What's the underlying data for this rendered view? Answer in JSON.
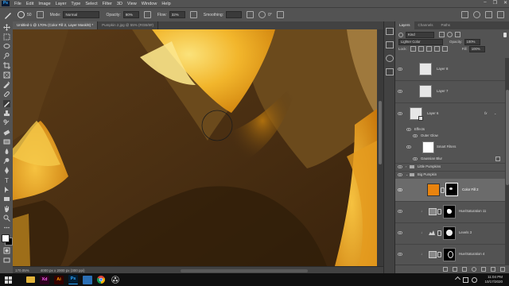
{
  "app": {
    "logo_text": "Ps"
  },
  "menu": [
    "File",
    "Edit",
    "Image",
    "Layer",
    "Type",
    "Select",
    "Filter",
    "3D",
    "View",
    "Window",
    "Help"
  ],
  "window_controls": [
    "–",
    "❐",
    "✕"
  ],
  "options_bar": {
    "brush_size": "50",
    "mode_label": "Mode:",
    "mode_value": "Normal",
    "opacity_label": "Opacity:",
    "opacity_value": "80%",
    "flow_label": "Flow:",
    "flow_value": "32%",
    "smoothing_label": "Smoothing:",
    "smoothing_value": "",
    "angle_value": "0°"
  },
  "doc_tabs": [
    {
      "label": "Untitled-1 @ 170% (Color Fill 2, Layer Mask/8) *",
      "active": true
    },
    {
      "label": "Pumpkin 2.jpg @ 55% (RGB/8#)",
      "active": false
    }
  ],
  "status": {
    "zoom": "170.05%",
    "doc_info": "4000 px x 2000 px (300 ppi)"
  },
  "panel": {
    "tabs": [
      "Layers",
      "Channels",
      "Paths"
    ],
    "filter_kind": "Kind",
    "blend_mode": "Lighter Color",
    "opacity_label": "Opacity:",
    "opacity_value": "100%",
    "lock_label": "Lock:",
    "fill_label": "Fill:",
    "fill_value": "100%"
  },
  "layers": [
    {
      "name": "Layer 8",
      "kind": "normal"
    },
    {
      "name": "Layer 7",
      "kind": "normal"
    },
    {
      "name": "Layer 6",
      "kind": "effects"
    },
    {
      "name": "Effects",
      "kind": "sub"
    },
    {
      "name": "Outer Glow",
      "kind": "sub"
    },
    {
      "name": "Smart Filters",
      "kind": "smart"
    },
    {
      "name": "Gaussian Blur",
      "kind": "sub"
    },
    {
      "name": "Little Pumpkins",
      "kind": "group"
    },
    {
      "name": "Big Pumpkin",
      "kind": "group"
    },
    {
      "name": "Color Fill 2",
      "kind": "fill"
    },
    {
      "name": "Hue/Saturation 11",
      "kind": "adj"
    },
    {
      "name": "Levels 3",
      "kind": "adj"
    },
    {
      "name": "Hue/Saturation 4",
      "kind": "adj"
    }
  ],
  "taskbar": {
    "apps": [
      "",
      "Xd",
      "Ai",
      "Ps",
      "",
      "",
      ""
    ],
    "time": "11:04 PM",
    "date": "10/17/2020"
  },
  "colors": {
    "accent_orange": "#e8830e",
    "ps_blue": "#31a8ff",
    "ai_orange": "#ff9a00",
    "xd_pink": "#ff61f6"
  }
}
